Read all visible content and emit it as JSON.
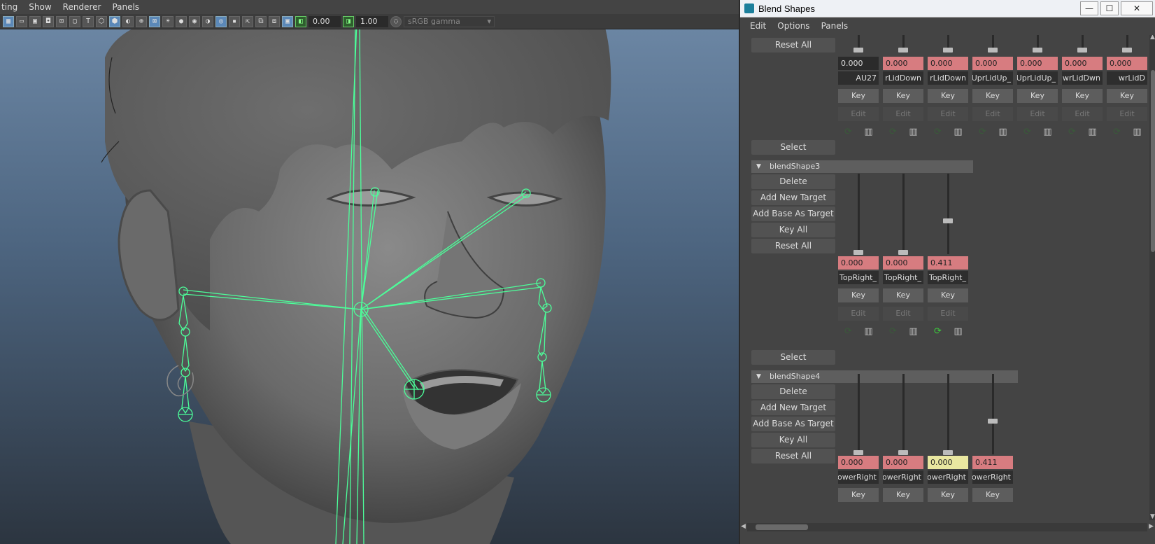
{
  "viewport": {
    "menu": [
      "ting",
      "Show",
      "Renderer",
      "Panels"
    ],
    "toolbar": {
      "field1": "0.00",
      "field2": "1.00",
      "colorspace": "sRGB gamma"
    }
  },
  "window": {
    "title": "Blend Shapes",
    "controls": {
      "minimize": "—",
      "maximize": "☐",
      "close": "✕"
    },
    "menu": [
      "Edit",
      "Options",
      "Panels"
    ]
  },
  "section_top": {
    "buttons": {
      "reset_all": "Reset All",
      "select": "Select"
    },
    "targets": [
      {
        "value": "0.000",
        "name": "AU27",
        "style": "dark"
      },
      {
        "value": "0.000",
        "name": "rLidDown",
        "style": "red"
      },
      {
        "value": "0.000",
        "name": "rLidDown",
        "style": "red"
      },
      {
        "value": "0.000",
        "name": "_UprLidUp",
        "style": "red"
      },
      {
        "value": "0.000",
        "name": "_UprLidUp",
        "style": "red"
      },
      {
        "value": "0.000",
        "name": "wrLidDwn",
        "style": "red"
      },
      {
        "value": "0.000",
        "name": "wrLidD",
        "style": "red"
      }
    ]
  },
  "blendShape3": {
    "title": "blendShape3",
    "buttons": {
      "delete": "Delete",
      "add_new_target": "Add New Target",
      "add_base_as_target": "Add Base As Target",
      "key_all": "Key All",
      "reset_all": "Reset All",
      "select": "Select"
    },
    "targets": [
      {
        "value": "0.000",
        "name": "_TopRight",
        "weight": 0.0,
        "active": false
      },
      {
        "value": "0.000",
        "name": "_TopRight",
        "weight": 0.0,
        "active": false
      },
      {
        "value": "0.411",
        "name": "_TopRight",
        "weight": 0.411,
        "active": true
      }
    ]
  },
  "blendShape4": {
    "title": "blendShape4",
    "buttons": {
      "delete": "Delete",
      "add_new_target": "Add New Target",
      "add_base_as_target": "Add Base As Target",
      "key_all": "Key All",
      "reset_all": "Reset All"
    },
    "targets": [
      {
        "value": "0.000",
        "name": "owerRight",
        "weight": 0.0,
        "style": "red"
      },
      {
        "value": "0.000",
        "name": "owerRight",
        "weight": 0.0,
        "style": "red"
      },
      {
        "value": "0.000",
        "name": "owerRight",
        "weight": 0.0,
        "style": "yellow"
      },
      {
        "value": "0.411",
        "name": "owerRight",
        "weight": 0.411,
        "style": "red"
      }
    ]
  },
  "labels": {
    "key": "Key",
    "edit": "Edit"
  },
  "colors": {
    "keyed_red": "#d77c80",
    "highlight_yellow": "#e9e7a0",
    "rig_green": "#4cff9a"
  }
}
